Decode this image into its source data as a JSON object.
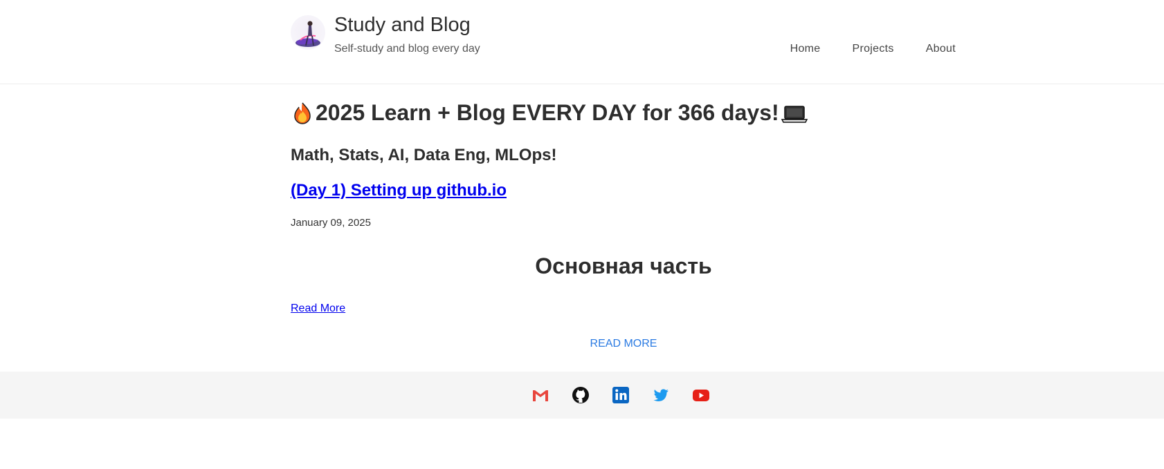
{
  "header": {
    "site_title": "Study and Blog",
    "site_subtitle": "Self-study and blog every day",
    "nav": [
      "Home",
      "Projects",
      "About"
    ]
  },
  "main": {
    "heading": "2025 Learn + Blog EVERY DAY for 366 days!",
    "heading_icons": [
      "fire-icon",
      "laptop-icon"
    ],
    "subtitle": "Math, Stats, AI, Data Eng, MLOps!",
    "post": {
      "title": "(Day 1) Setting up github.io",
      "date": "January 09, 2025",
      "section_heading": "Основная часть",
      "read_more": "Read More"
    },
    "read_more_button": "READ MORE"
  },
  "footer": {
    "social_icons": [
      "gmail-icon",
      "github-icon",
      "linkedin-icon",
      "twitter-icon",
      "youtube-icon"
    ]
  },
  "colors": {
    "link": "#0000ee",
    "accent": "#2a7ae2",
    "footer_bg": "#f5f5f5"
  }
}
